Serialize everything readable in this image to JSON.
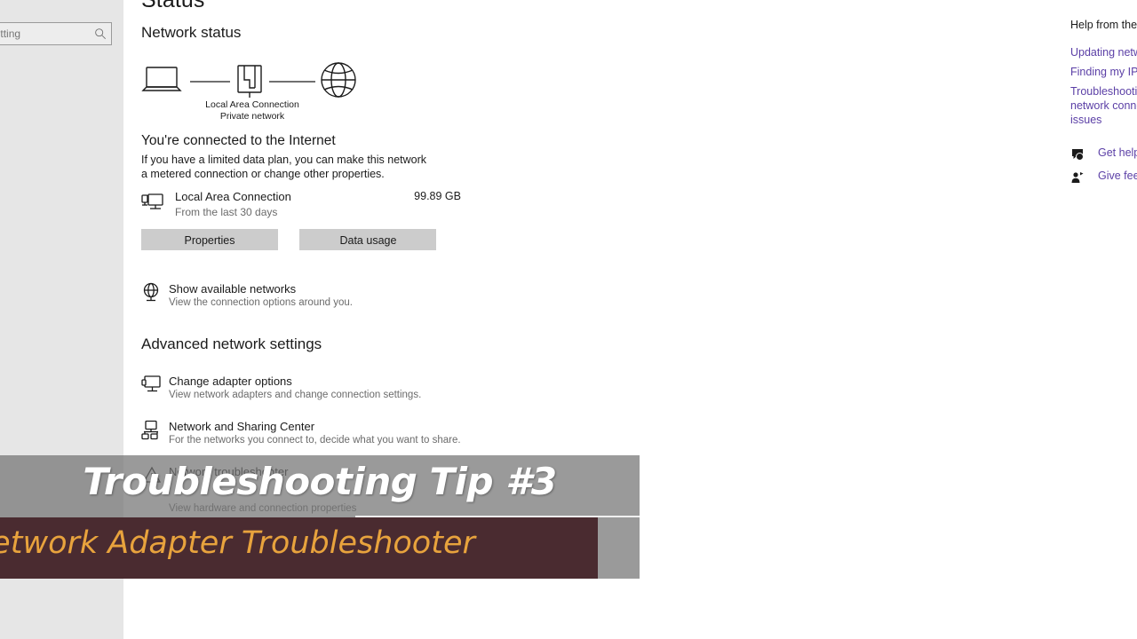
{
  "sidebar": {
    "search_placeholder": "Find a setting",
    "search_value": "",
    "search_icon": "search-icon",
    "stub_text": "t"
  },
  "main": {
    "page_title": "Status",
    "network_status_heading": "Network status",
    "advanced_heading": "Advanced network settings",
    "diagram": {
      "device_icon": "laptop-icon",
      "adapter_icon": "ethernet-port-icon",
      "internet_icon": "globe-icon",
      "label_line1": "Local Area Connection",
      "label_line2": "Private network"
    },
    "connected": {
      "title": "You're connected to the Internet",
      "description": "If you have a limited data plan, you can make this network a metered connection or change other properties.",
      "icon": "monitor-network-icon",
      "name": "Local Area Connection",
      "subtitle": "From the last 30 days",
      "usage": "99.89 GB"
    },
    "buttons": {
      "properties": "Properties",
      "data_usage": "Data usage"
    },
    "items": [
      {
        "icon": "globe-monitor-icon",
        "title": "Show available networks",
        "subtitle": "View the connection options around you."
      },
      {
        "icon": "monitor-icon",
        "title": "Change adapter options",
        "subtitle": "View network adapters and change connection settings."
      },
      {
        "icon": "network-sharing-icon",
        "title": "Network and Sharing Center",
        "subtitle": "For the networks you connect to, decide what you want to share."
      },
      {
        "icon": "troubleshooter-icon",
        "title": "Network troubleshooter",
        "subtitle": ""
      },
      {
        "icon": "hardware-icon",
        "title": "",
        "subtitle": "View hardware and connection properties"
      }
    ]
  },
  "right_panel": {
    "heading": "Help from the web",
    "links": [
      "Updating network adapter drivers",
      "Finding my IP address",
      "Troubleshooting network connection issues"
    ],
    "actions": [
      {
        "icon": "help-bubble-icon",
        "label": "Get help"
      },
      {
        "icon": "feedback-person-icon",
        "label": "Give feedback"
      }
    ]
  },
  "overlay": {
    "title": "Troubleshooting Tip #3",
    "subtitle": "Network Adapter Troubleshooter",
    "title_color": "#ffffff",
    "subtitle_color": "#e8a33d",
    "bar_color": "#4a2b30",
    "panel_color": "#737373"
  }
}
